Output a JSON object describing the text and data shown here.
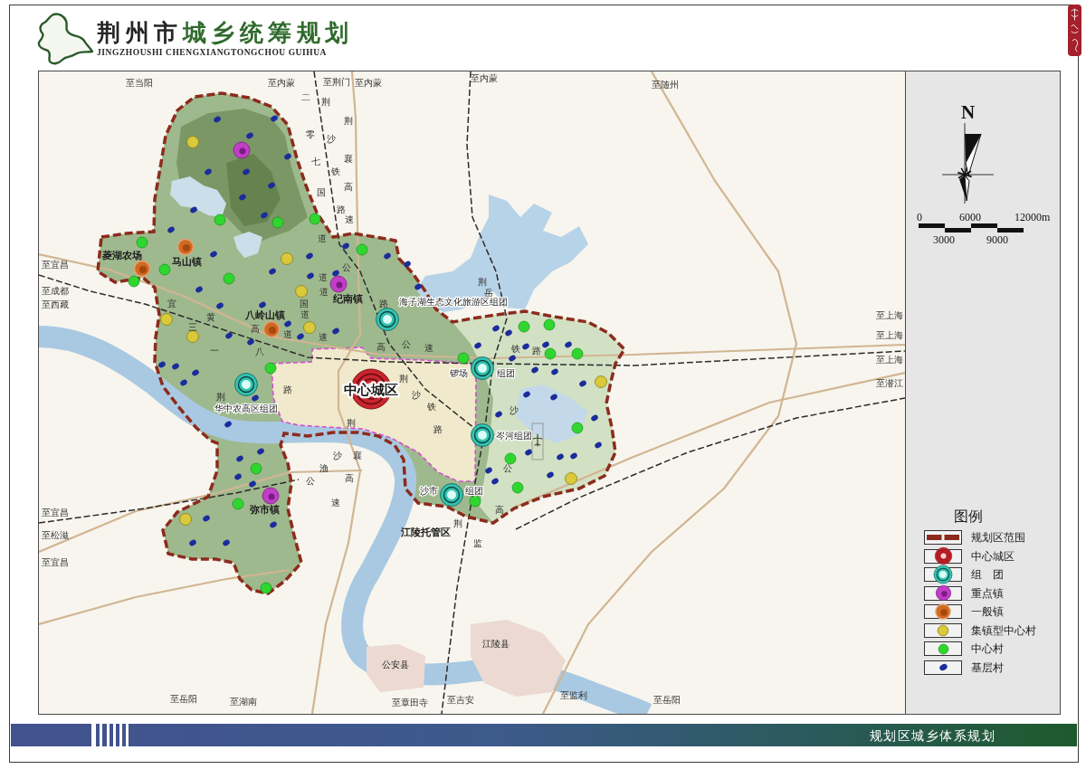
{
  "header": {
    "title_city": "荆州市",
    "title_subject": "城乡统筹规划",
    "subtitle": "JINGZHOUSHI CHENGXIANGTONGCHOU GUIHUA"
  },
  "map": {
    "direction_labels": [
      "至当阳",
      "至内蒙",
      "至荆门",
      "至内蒙",
      "至内蒙",
      "至随州",
      "至宜昌",
      "至成都",
      "至西藏",
      "至上海",
      "至上海",
      "至上海",
      "至潜江",
      "至宜昌",
      "至松滋",
      "至宜昌",
      "至岳阳",
      "至湖南",
      "至章田寺",
      "至吉安",
      "至监利",
      "至岳阳"
    ],
    "road_labels": [
      "二",
      "荆",
      "荆",
      "零",
      "沙",
      "七",
      "襄",
      "铁",
      "国",
      "高",
      "路",
      "速",
      "道",
      "公",
      "道",
      "荆",
      "道",
      "岳",
      "宜",
      "国",
      "路",
      "黄",
      "道",
      "三",
      "高",
      "道",
      "速",
      "一",
      "八",
      "高",
      "公",
      "速",
      "铁",
      "路",
      "荆",
      "荆",
      "路",
      "沙",
      "铁",
      "沙",
      "荆",
      "路",
      "沙",
      "襄",
      "渔",
      "公",
      "公",
      "高",
      "速",
      "高",
      "荆",
      "监"
    ],
    "place_labels": [
      {
        "text": "菱湖农场",
        "kind": "town"
      },
      {
        "text": "马山镇",
        "kind": "town"
      },
      {
        "text": "纪南镇",
        "kind": "town"
      },
      {
        "text": "海子湖生态文化旅游区组团",
        "kind": "cluster"
      },
      {
        "text": "八岭山镇",
        "kind": "town"
      },
      {
        "text": "锣场",
        "kind": "cluster"
      },
      {
        "text": "组团",
        "kind": "cluster"
      },
      {
        "text": "中心城区",
        "kind": "core"
      },
      {
        "text": "华中农高区组团",
        "kind": "cluster"
      },
      {
        "text": "岑河组团",
        "kind": "cluster"
      },
      {
        "text": "沙市",
        "kind": "cluster"
      },
      {
        "text": "组团",
        "kind": "cluster"
      },
      {
        "text": "弥市镇",
        "kind": "town"
      },
      {
        "text": "江陵托管区",
        "kind": "area"
      },
      {
        "text": "江陵县",
        "kind": "county"
      },
      {
        "text": "公安县",
        "kind": "county"
      }
    ],
    "markers": [
      {
        "kind": "center_city"
      },
      {
        "kind": "cluster"
      },
      {
        "kind": "cluster"
      },
      {
        "kind": "cluster"
      },
      {
        "kind": "cluster"
      },
      {
        "kind": "cluster"
      },
      {
        "kind": "key_town"
      },
      {
        "kind": "key_town"
      },
      {
        "kind": "key_town"
      },
      {
        "kind": "town"
      },
      {
        "kind": "town"
      },
      {
        "kind": "town"
      },
      {
        "kind": "hub_village"
      },
      {
        "kind": "hub_village"
      },
      {
        "kind": "hub_village"
      },
      {
        "kind": "hub_village"
      },
      {
        "kind": "hub_village"
      },
      {
        "kind": "hub_village"
      },
      {
        "kind": "hub_village"
      },
      {
        "kind": "hub_village"
      },
      {
        "kind": "hub_village"
      },
      {
        "kind": "center_village"
      },
      {
        "kind": "center_village"
      },
      {
        "kind": "center_village"
      },
      {
        "kind": "center_village"
      },
      {
        "kind": "center_village"
      },
      {
        "kind": "center_village"
      },
      {
        "kind": "center_village"
      },
      {
        "kind": "center_village"
      },
      {
        "kind": "center_village"
      },
      {
        "kind": "center_village"
      },
      {
        "kind": "center_village"
      },
      {
        "kind": "center_village"
      },
      {
        "kind": "center_village"
      },
      {
        "kind": "center_village"
      },
      {
        "kind": "center_village"
      },
      {
        "kind": "center_village"
      },
      {
        "kind": "center_village"
      },
      {
        "kind": "center_village"
      },
      {
        "kind": "center_village"
      },
      {
        "kind": "center_village"
      },
      {
        "kind": "center_village"
      },
      {
        "kind": "base_village"
      },
      {
        "kind": "base_village"
      },
      {
        "kind": "base_village"
      },
      {
        "kind": "base_village"
      },
      {
        "kind": "base_village"
      },
      {
        "kind": "base_village"
      },
      {
        "kind": "base_village"
      },
      {
        "kind": "base_village"
      },
      {
        "kind": "base_village"
      },
      {
        "kind": "base_village"
      },
      {
        "kind": "base_village"
      },
      {
        "kind": "base_village"
      },
      {
        "kind": "base_village"
      },
      {
        "kind": "base_village"
      },
      {
        "kind": "base_village"
      },
      {
        "kind": "base_village"
      },
      {
        "kind": "base_village"
      },
      {
        "kind": "base_village"
      },
      {
        "kind": "base_village"
      },
      {
        "kind": "base_village"
      },
      {
        "kind": "base_village"
      },
      {
        "kind": "base_village"
      },
      {
        "kind": "base_village"
      },
      {
        "kind": "base_village"
      },
      {
        "kind": "base_village"
      },
      {
        "kind": "base_village"
      },
      {
        "kind": "base_village"
      },
      {
        "kind": "base_village"
      },
      {
        "kind": "base_village"
      },
      {
        "kind": "base_village"
      },
      {
        "kind": "base_village"
      },
      {
        "kind": "base_village"
      },
      {
        "kind": "base_village"
      },
      {
        "kind": "base_village"
      },
      {
        "kind": "base_village"
      },
      {
        "kind": "base_village"
      },
      {
        "kind": "base_village"
      },
      {
        "kind": "base_village"
      },
      {
        "kind": "base_village"
      },
      {
        "kind": "base_village"
      },
      {
        "kind": "base_village"
      },
      {
        "kind": "base_village"
      },
      {
        "kind": "base_village"
      },
      {
        "kind": "base_village"
      },
      {
        "kind": "base_village"
      },
      {
        "kind": "base_village"
      },
      {
        "kind": "base_village"
      },
      {
        "kind": "base_village"
      },
      {
        "kind": "base_village"
      },
      {
        "kind": "base_village"
      },
      {
        "kind": "base_village"
      },
      {
        "kind": "base_village"
      },
      {
        "kind": "base_village"
      },
      {
        "kind": "base_village"
      },
      {
        "kind": "base_village"
      },
      {
        "kind": "base_village"
      },
      {
        "kind": "base_village"
      },
      {
        "kind": "base_village"
      },
      {
        "kind": "base_village"
      },
      {
        "kind": "base_village"
      },
      {
        "kind": "base_village"
      },
      {
        "kind": "base_village"
      },
      {
        "kind": "base_village"
      }
    ]
  },
  "side_panel": {
    "north_label": "N",
    "scale_labels": [
      "0",
      "6000",
      "12000m",
      "3000",
      "9000"
    ],
    "legend": {
      "title": "图例",
      "items": [
        {
          "label": "规划区范围",
          "kind": "boundary",
          "color": "#8c2b1d"
        },
        {
          "label": "中心城区",
          "kind": "center_city",
          "color": "#c9252e"
        },
        {
          "label": "组　团",
          "kind": "cluster",
          "color": "#34c3b1"
        },
        {
          "label": "重点镇",
          "kind": "key_town",
          "color": "#c13ec7"
        },
        {
          "label": "一般镇",
          "kind": "town",
          "color": "#cf6a24"
        },
        {
          "label": "集镇型中心村",
          "kind": "hub_village",
          "color": "#d9c93b"
        },
        {
          "label": "中心村",
          "kind": "center_village",
          "color": "#2fd62f"
        },
        {
          "label": "基层村",
          "kind": "base_village",
          "color": "#1b2c9c"
        }
      ]
    }
  },
  "footer": {
    "title": "规划区城乡体系规划"
  }
}
